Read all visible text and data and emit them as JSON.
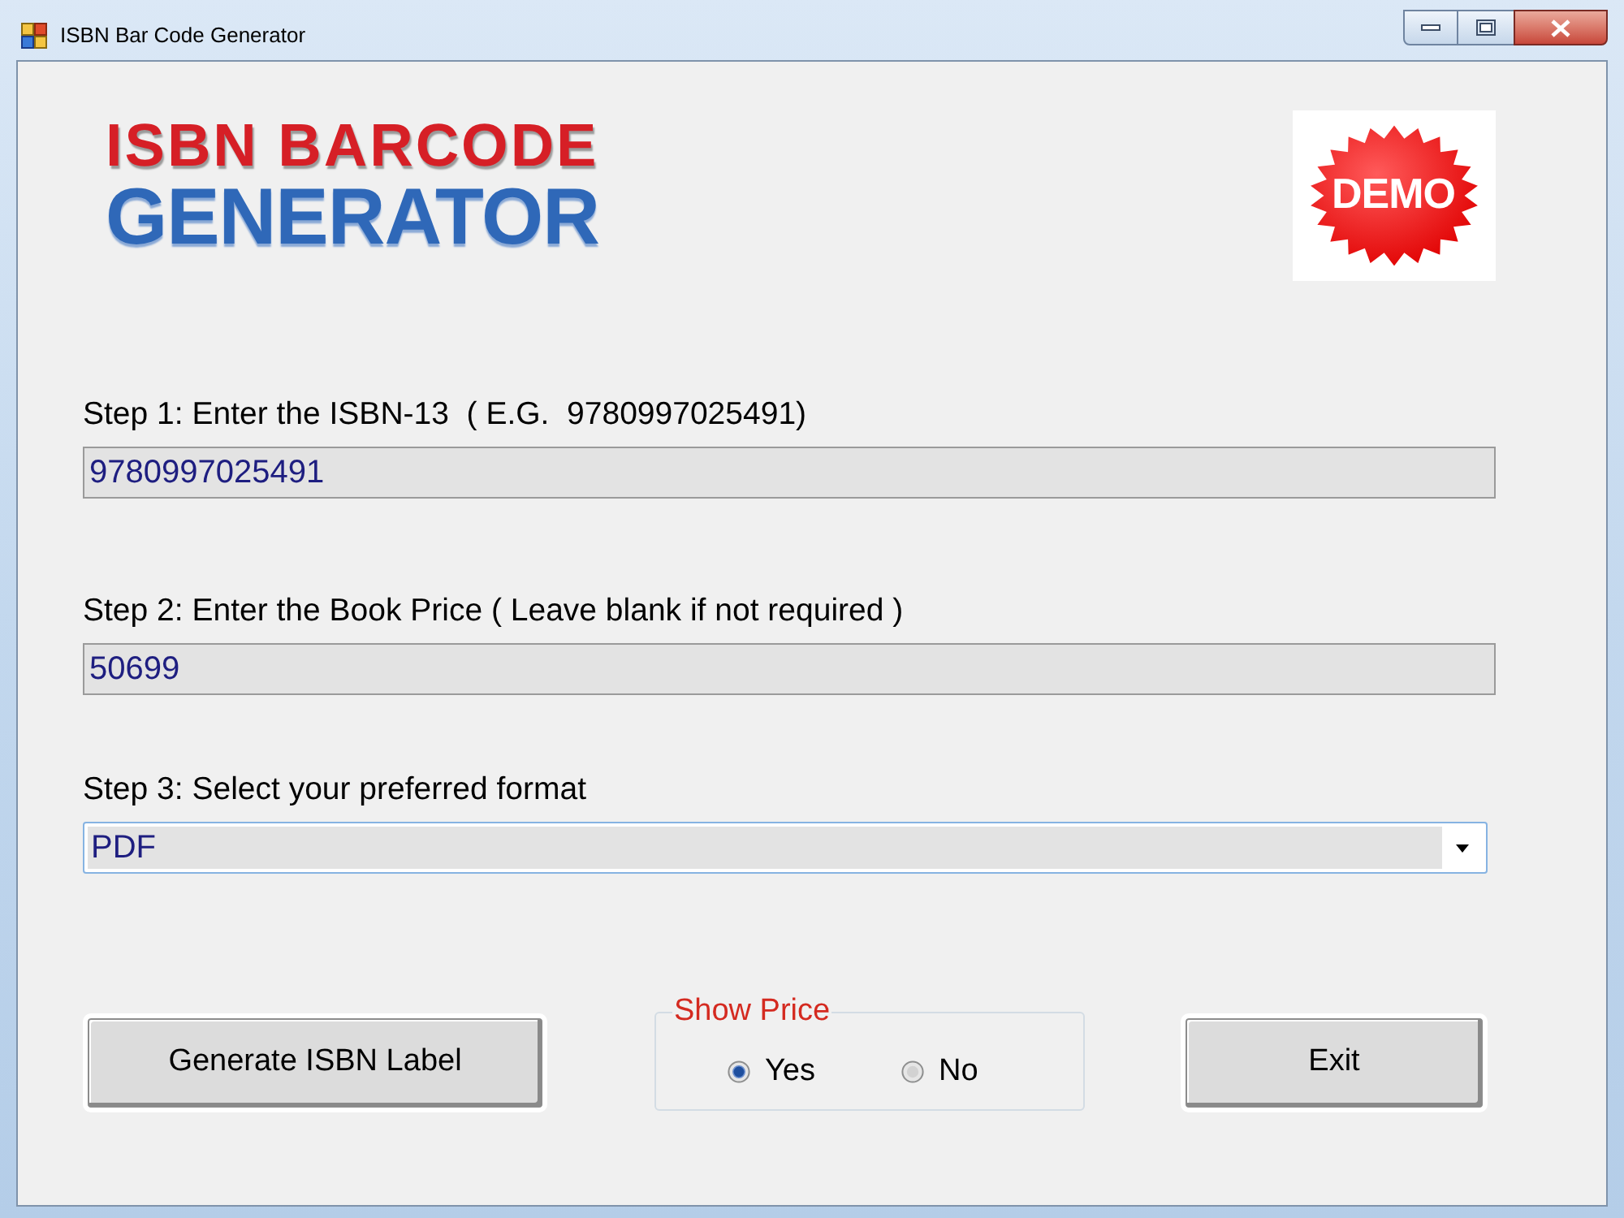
{
  "window": {
    "title": "ISBN Bar Code Generator"
  },
  "logo": {
    "line_1": "ISBN BARCODE",
    "line_2": "GENERATOR"
  },
  "badge": {
    "text": "DEMO"
  },
  "steps": [
    {
      "kind": "text",
      "label": "Step 1: Enter the ISBN-13  ( E.G.  9780997025491)",
      "value": "9780997025491"
    },
    {
      "kind": "text",
      "label": "Step 2: Enter the Book Price ( Leave blank if not required )",
      "value": "50699"
    },
    {
      "kind": "dropdown",
      "label": "Step 3: Select your preferred format",
      "value": "PDF"
    }
  ],
  "generate_button": {
    "label": "Generate ISBN Label"
  },
  "show_price": {
    "title": "Show Price",
    "options": [
      {
        "label": "Yes",
        "selected": true
      },
      {
        "label": "No",
        "selected": false
      }
    ]
  },
  "exit_button": {
    "label": "Exit"
  }
}
